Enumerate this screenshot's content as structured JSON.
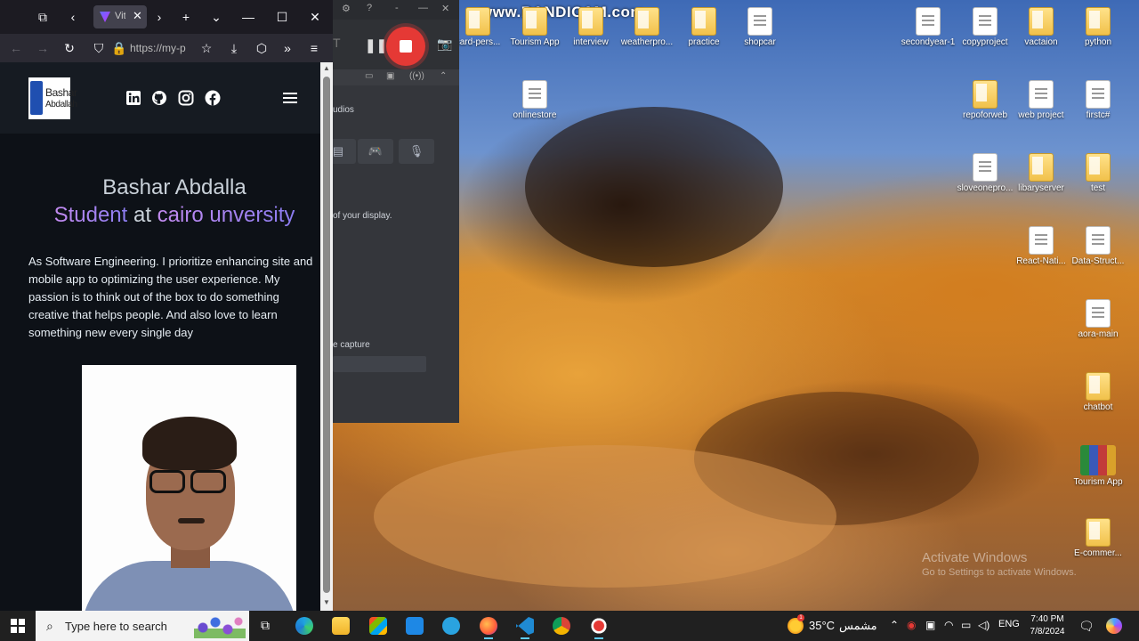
{
  "watermark": "www.BANDICAM.com",
  "activation": {
    "line1": "Activate Windows",
    "line2": "Go to Settings to activate Windows."
  },
  "desktop_icons": [
    {
      "label": "card-pers...",
      "kind": "folder"
    },
    {
      "label": "Tourism App",
      "kind": "folder"
    },
    {
      "label": "interview",
      "kind": "folder"
    },
    {
      "label": "weatherpro...",
      "kind": "folder"
    },
    {
      "label": "practice",
      "kind": "folder"
    },
    {
      "label": "shopcar",
      "kind": "file"
    },
    {
      "label": "onlinestore",
      "kind": "file"
    },
    {
      "label": "secondyear-1",
      "kind": "file"
    },
    {
      "label": "copyproject",
      "kind": "file"
    },
    {
      "label": "vactaion",
      "kind": "folder"
    },
    {
      "label": "python",
      "kind": "folder"
    },
    {
      "label": "repoforweb",
      "kind": "folder"
    },
    {
      "label": "web project",
      "kind": "file"
    },
    {
      "label": "firstc#",
      "kind": "file"
    },
    {
      "label": "sloveonepro...",
      "kind": "file"
    },
    {
      "label": "libaryserver",
      "kind": "folder"
    },
    {
      "label": "test",
      "kind": "folder"
    },
    {
      "label": "React-Nati...",
      "kind": "file"
    },
    {
      "label": "Data-Struct...",
      "kind": "file"
    },
    {
      "label": "aora-main",
      "kind": "file"
    },
    {
      "label": "chatbot",
      "kind": "folder"
    },
    {
      "label": "Tourism App",
      "kind": "archive"
    },
    {
      "label": "E-commer...",
      "kind": "folder"
    }
  ],
  "browser": {
    "tab_title": "Vit",
    "url": "https://my-p",
    "site": {
      "logo_line1": "Bashar",
      "logo_line2": "Abdallah",
      "social_icons": [
        "linkedin-icon",
        "github-icon",
        "instagram-icon",
        "facebook-icon"
      ],
      "hero_name": "Bashar Abdalla",
      "hero_role_1": "Student",
      "hero_role_at": "at",
      "hero_role_2": "cairo unversity",
      "bio": "As Software Engineering. I prioritize enhancing site and mobile app to optimizing the user experience. My passion is to think out of the box to do something creative that helps people. And also love to learn something new every single day",
      "photo_bg": "#fdfdfd"
    }
  },
  "bandicam": {
    "subtab": "udios",
    "line1": "of your display.",
    "line2": "e capture",
    "accent": "#e53935"
  },
  "taskbar": {
    "search_placeholder": "Type here to search",
    "weather_temp": "35°C",
    "weather_desc": "مشمس",
    "weather_badge": "1",
    "language": "ENG",
    "time": "7:40 PM",
    "date": "7/8/2024"
  }
}
